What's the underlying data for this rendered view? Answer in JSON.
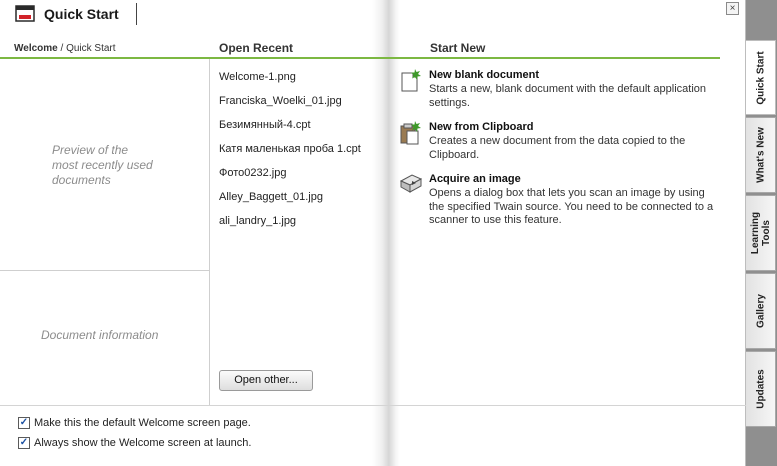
{
  "header": {
    "title": "Quick Start",
    "close_glyph": "×"
  },
  "breadcrumb": {
    "root": "Welcome",
    "separator": " / ",
    "current": "Quick Start"
  },
  "columns": {
    "open_recent": "Open Recent",
    "start_new": "Start New"
  },
  "left": {
    "preview_placeholder": [
      "Preview of the",
      "most recently used",
      "documents"
    ],
    "info_placeholder": "Document information"
  },
  "recent_files": [
    "Welcome-1.png",
    "Franciska_Woelki_01.jpg",
    "Безимянный-4.cpt",
    "Катя маленькая проба 1.cpt",
    "Фото0232.jpg",
    "Alley_Baggett_01.jpg",
    "ali_landry_1.jpg"
  ],
  "open_other_label": "Open other...",
  "tasks": [
    {
      "title": "New blank document",
      "desc": "Starts a new, blank document with the default application settings.",
      "icon": "new-document-icon"
    },
    {
      "title": "New from Clipboard",
      "desc": "Creates a new document from the data copied to the Clipboard.",
      "icon": "clipboard-icon"
    },
    {
      "title": "Acquire an image",
      "desc": "Opens a dialog box that lets you scan an image by using the specified Twain source. You need to be connected to a scanner to use this feature.",
      "icon": "scanner-icon"
    }
  ],
  "options": [
    {
      "label": "Make this the default Welcome screen page.",
      "checked": true
    },
    {
      "label": "Always show the Welcome screen at launch.",
      "checked": true
    }
  ],
  "tabs": [
    {
      "label": "Quick Start",
      "active": true
    },
    {
      "label": "What's New",
      "active": false
    },
    {
      "label": "Learning Tools",
      "active": false
    },
    {
      "label": "Gallery",
      "active": false
    },
    {
      "label": "Updates",
      "active": false
    }
  ],
  "colors": {
    "accent_green": "#7cb842",
    "placeholder_gray": "#8c8c8c"
  }
}
